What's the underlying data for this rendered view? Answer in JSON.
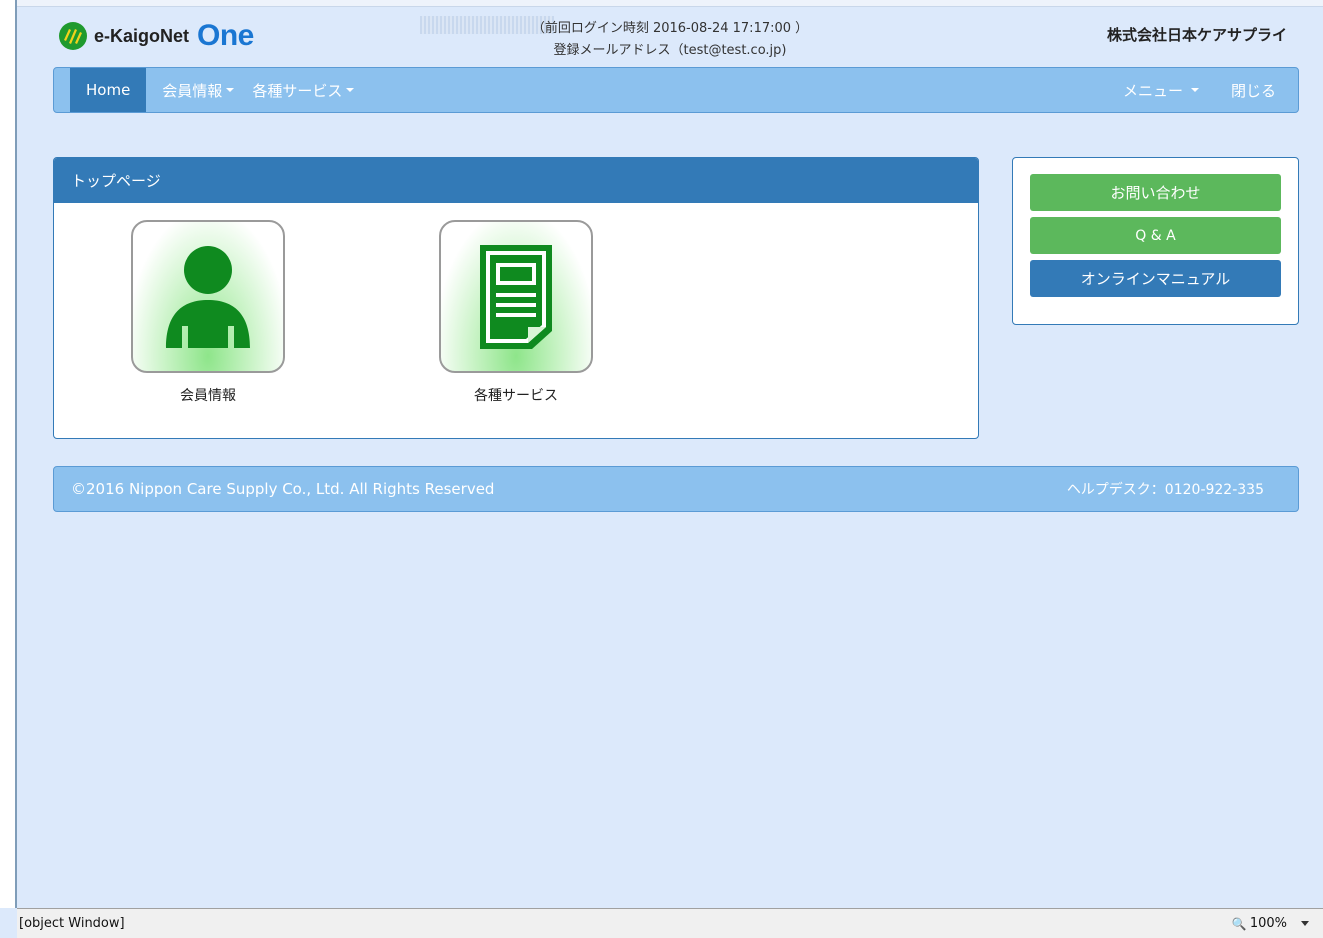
{
  "header": {
    "logo_text": "e-KaigoNet",
    "logo_one": "One",
    "last_login": "（前回ログイン時刻 2016-08-24 17:17:00 ）",
    "email": "登録メールアドレス（test@test.co.jp)",
    "company": "株式会社日本ケアサプライ"
  },
  "nav": {
    "home": "Home",
    "member": "会員情報",
    "services": "各種サービス",
    "menu": "メニュー",
    "close": "閉じる"
  },
  "main_panel": {
    "title": "トップページ",
    "tiles": [
      {
        "label": "会員情報",
        "icon": "person-icon"
      },
      {
        "label": "各種サービス",
        "icon": "document-icon"
      }
    ]
  },
  "side_panel": {
    "contact": "お問い合わせ",
    "qa": "Q & A",
    "manual": "オンラインマニュアル"
  },
  "footer": {
    "copyright": "©2016 Nippon Care Supply Co., Ltd. All Rights Reserved",
    "helpdesk": "ヘルプデスク：0120-922-335"
  },
  "statusbar": {
    "text": "[object Window]",
    "zoom": "100%"
  },
  "colors": {
    "background": "#dce9fb",
    "navbar": "#8cc1ee",
    "primary": "#337ab7",
    "success": "#5cb85c",
    "icon_green": "#0f8a1f"
  }
}
